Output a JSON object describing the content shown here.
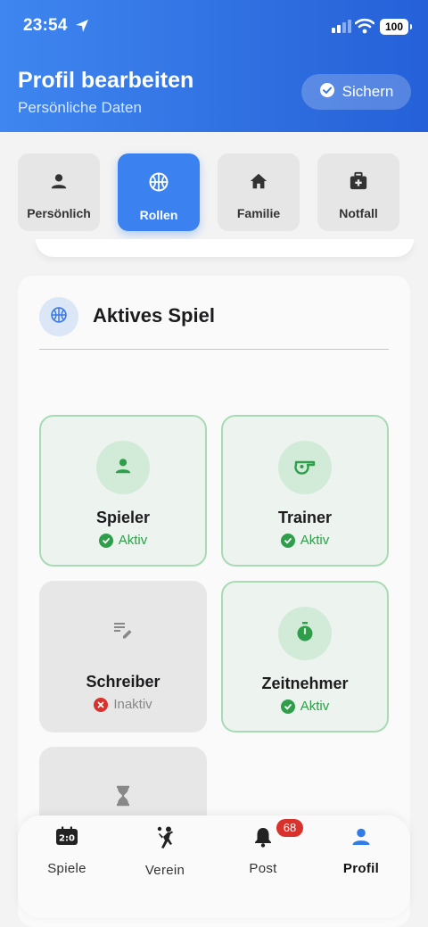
{
  "status_bar": {
    "time": "23:54",
    "battery": "100"
  },
  "header": {
    "title": "Profil bearbeiten",
    "subtitle": "Persönliche Daten",
    "save_label": "Sichern"
  },
  "tabs": [
    {
      "label": "Persönlich",
      "icon": "person-icon",
      "active": false
    },
    {
      "label": "Rollen",
      "icon": "basketball-icon",
      "active": true
    },
    {
      "label": "Familie",
      "icon": "home-icon",
      "active": false
    },
    {
      "label": "Notfall",
      "icon": "medical-kit-icon",
      "active": false
    }
  ],
  "section": {
    "title": "Aktives Spiel",
    "icon": "basketball-icon"
  },
  "roles": [
    {
      "name": "Spieler",
      "status": "Aktiv",
      "active": true,
      "icon": "person-icon"
    },
    {
      "name": "Trainer",
      "status": "Aktiv",
      "active": true,
      "icon": "whistle-icon"
    },
    {
      "name": "Schreiber",
      "status": "Inaktiv",
      "active": false,
      "icon": "edit-notes-icon"
    },
    {
      "name": "Zeitnehmer",
      "status": "Aktiv",
      "active": true,
      "icon": "stopwatch-icon"
    },
    {
      "name": "",
      "status": "",
      "active": false,
      "icon": "hourglass-icon"
    }
  ],
  "colors": {
    "header_start": "#3f86f0",
    "header_end": "#2560d8",
    "accent": "#3b82f0",
    "active_green": "#2f9e4a",
    "inactive_red": "#d9312b"
  },
  "bottom_nav": [
    {
      "label": "Spiele",
      "icon": "scoreboard-icon",
      "active": false
    },
    {
      "label": "Verein",
      "icon": "handball-player-icon",
      "active": false
    },
    {
      "label": "Post",
      "icon": "bell-icon",
      "active": false,
      "badge": "68"
    },
    {
      "label": "Profil",
      "icon": "person-icon",
      "active": true
    }
  ]
}
